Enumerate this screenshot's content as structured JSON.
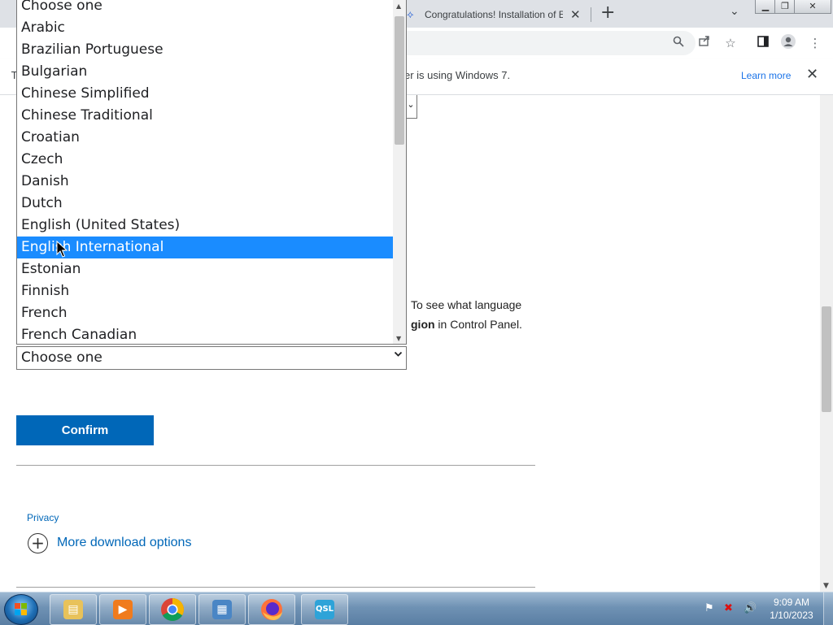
{
  "browser": {
    "tab_title": "Congratulations! Installation of E",
    "tab_close": "✕",
    "new_tab": "+",
    "tab_search": "⌄",
    "window_buttons": [
      "▁",
      "❐",
      "✕"
    ]
  },
  "infobar": {
    "lead": "T",
    "message": "er is using Windows 7.",
    "learn_more": "Learn more",
    "close": "✕"
  },
  "page": {
    "text_line1": "To see what language",
    "text_line2_bold": "gion",
    "text_line2_rest": " in Control Panel.",
    "select_value": "Choose one",
    "confirm_label": "Confirm",
    "privacy_label": "Privacy",
    "more_options_label": "More download options"
  },
  "dropdown": {
    "items": [
      "Choose one",
      "Arabic",
      "Brazilian Portuguese",
      "Bulgarian",
      "Chinese Simplified",
      "Chinese Traditional",
      "Croatian",
      "Czech",
      "Danish",
      "Dutch",
      "English (United States)",
      "English International",
      "Estonian",
      "Finnish",
      "French",
      "French Canadian"
    ],
    "highlighted_index": 11,
    "highlight_color": "#1a8cff"
  },
  "taskbar": {
    "apps": [
      "file-explorer-icon",
      "media-player-icon",
      "chrome-icon",
      "control-panel-icon",
      "firefox-icon",
      "qsl-app-icon"
    ],
    "time": "9:09 AM",
    "date": "1/10/2023"
  }
}
